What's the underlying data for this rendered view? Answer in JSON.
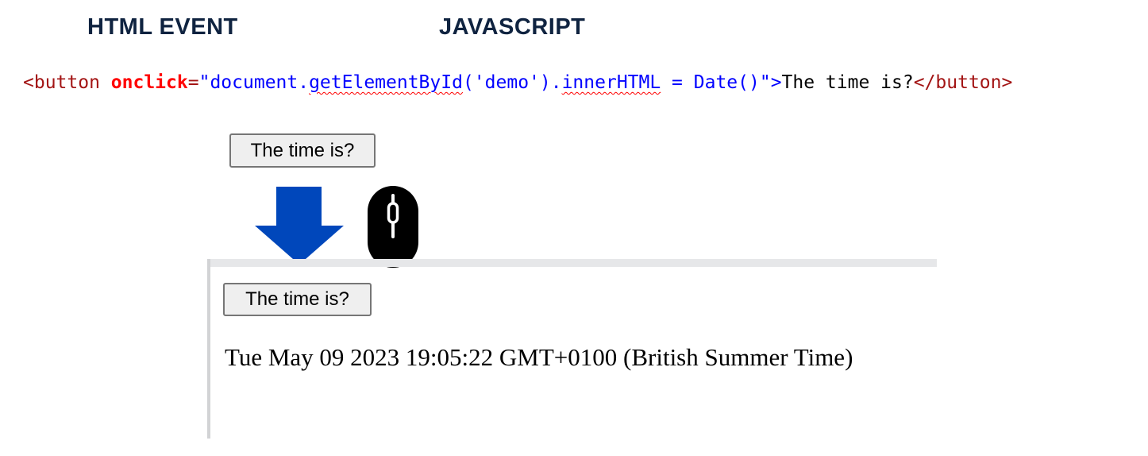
{
  "headings": {
    "html_event": "HTML EVENT",
    "javascript": "JAVASCRIPT"
  },
  "code": {
    "open_tag": "<button",
    "attr": "onclick",
    "eq": "=",
    "quote_open": "\"",
    "str_part1": "document.",
    "str_squiggle1": "getElementById",
    "str_part2": "('demo').",
    "str_squiggle2": "innerHTML",
    "str_part3": " = Date()",
    "quote_close": "\"",
    "gt": ">",
    "inner_text": "The time is?",
    "close_tag": "</button>"
  },
  "demo_before": {
    "button_label": "The time is?"
  },
  "demo_after": {
    "button_label": "The time is?",
    "result_text": "Tue May 09 2023 19:05:22 GMT+0100 (British Summer Time)"
  },
  "icons": {
    "arrow": "down-arrow-icon",
    "mouse": "mouse-icon"
  },
  "colors": {
    "heading": "#0f2340",
    "arrow": "#0047bb",
    "tag": "#a31515",
    "attribute": "#ff0000",
    "string": "#0000ff"
  }
}
